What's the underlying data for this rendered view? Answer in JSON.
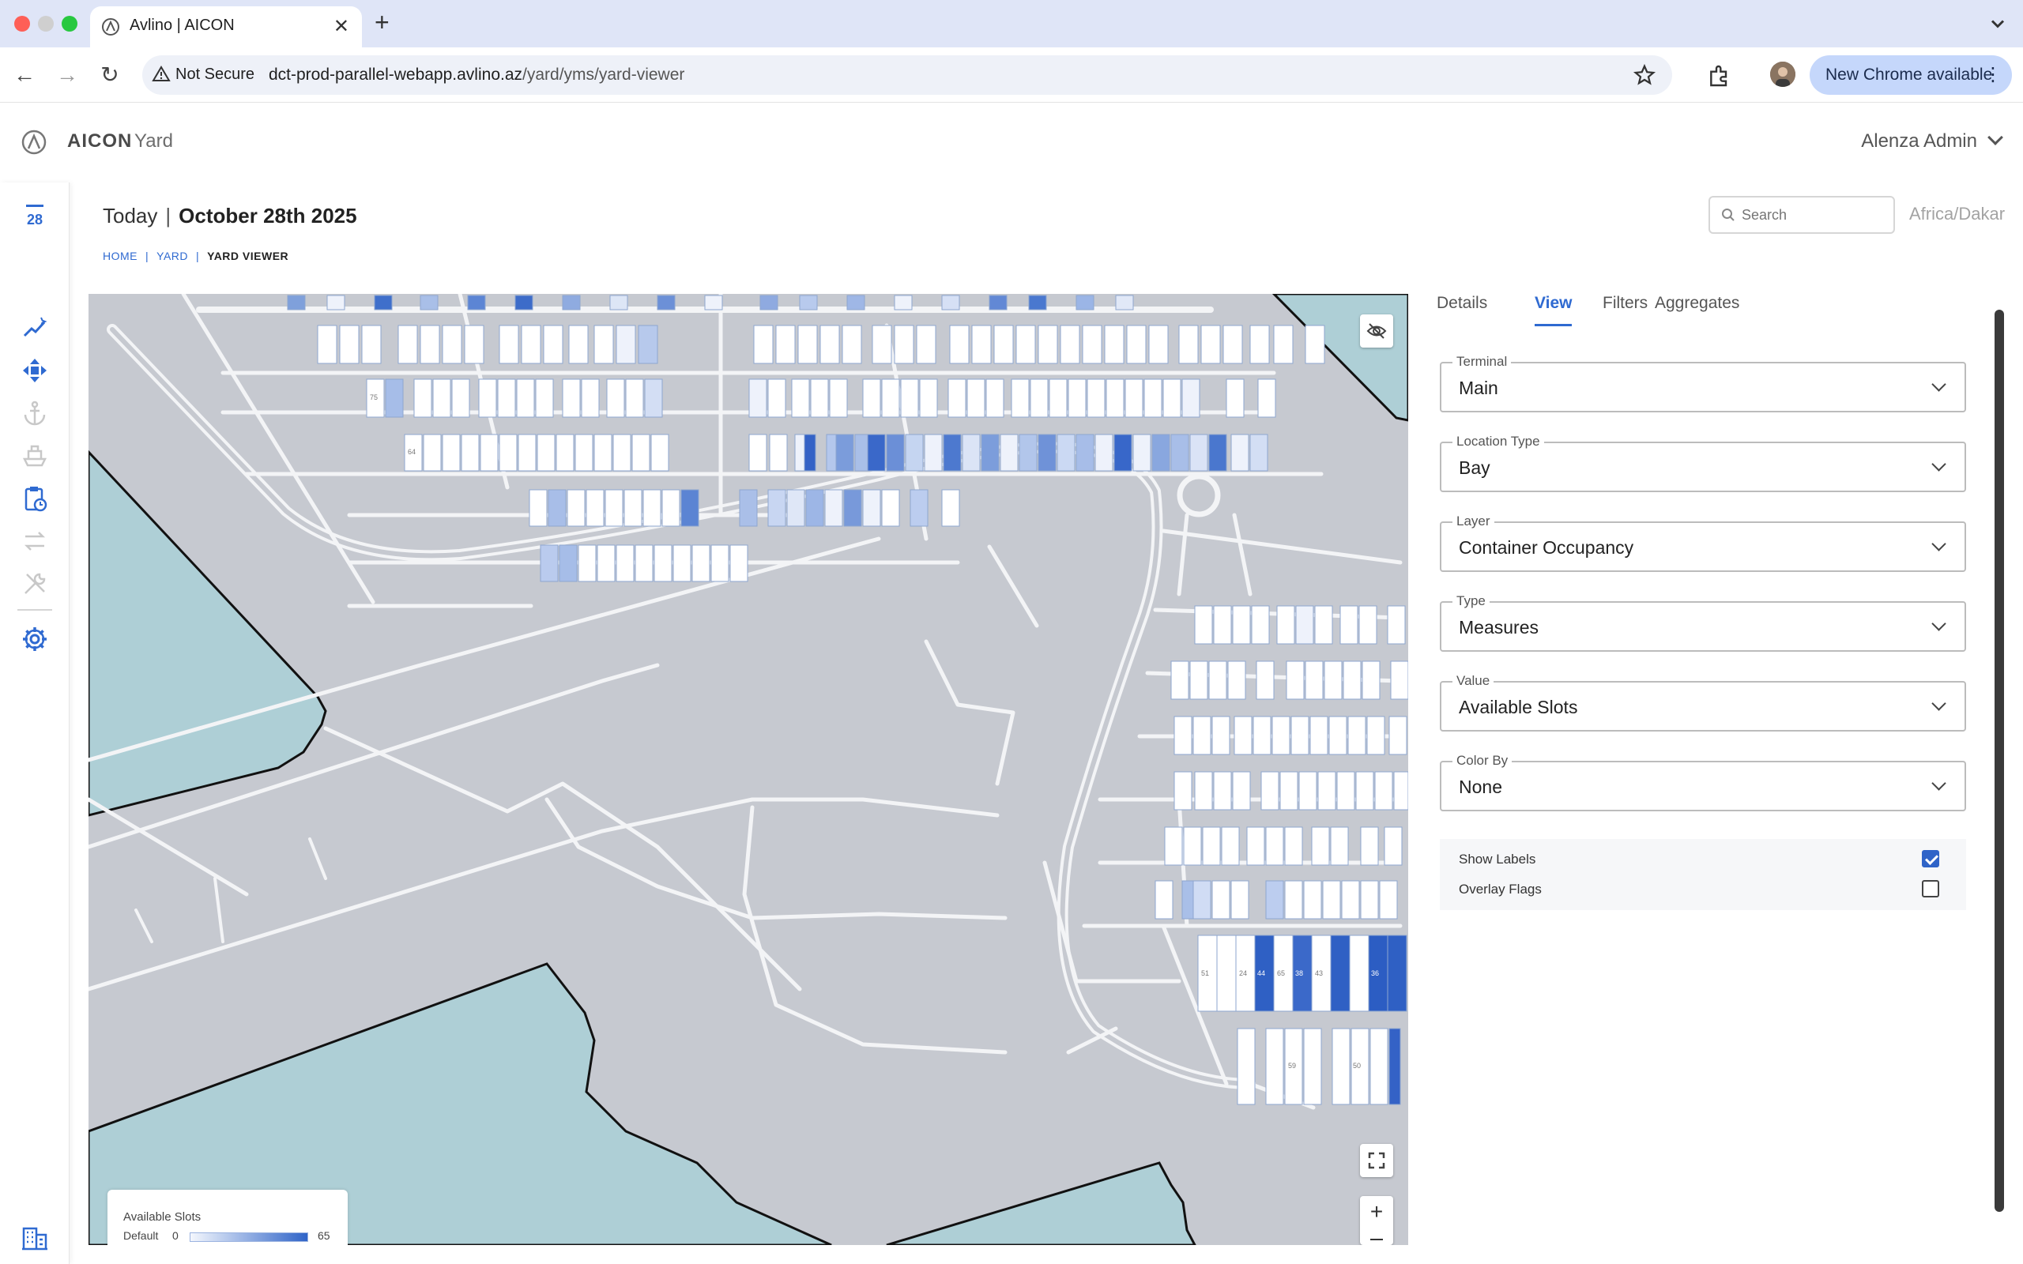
{
  "browser": {
    "tab_title": "Avlino | AICON",
    "security_label": "Not Secure",
    "url_host": "dct-prod-parallel-webapp.avlino.az",
    "url_path": "/yard/yms/yard-viewer",
    "update_label": "New Chrome available"
  },
  "app": {
    "brand": "AICON",
    "module": "Yard",
    "user_name": "Alenza Admin",
    "rail_calendar_day": "28"
  },
  "page": {
    "today_label": "Today",
    "date": "October 28th 2025",
    "breadcrumb": [
      "HOME",
      "YARD",
      "YARD VIEWER"
    ],
    "search_placeholder": "Search",
    "timezone": "Africa/Dakar"
  },
  "legend": {
    "title": "Available Slots",
    "row_label": "Default",
    "min": "0",
    "max": "65"
  },
  "map_labels": [
    "75",
    "64",
    "44",
    "38",
    "36",
    "51",
    "24",
    "65",
    "43",
    "50",
    "59"
  ],
  "panel": {
    "tabs": [
      "Details",
      "View",
      "Filters",
      "Aggregates"
    ],
    "active_tab": "View",
    "fields": [
      {
        "label": "Terminal",
        "value": "Main"
      },
      {
        "label": "Location Type",
        "value": "Bay"
      },
      {
        "label": "Layer",
        "value": "Container Occupancy"
      },
      {
        "label": "Type",
        "value": "Measures"
      },
      {
        "label": "Value",
        "value": "Available Slots"
      },
      {
        "label": "Color By",
        "value": "None"
      }
    ],
    "options": [
      {
        "label": "Show Labels",
        "checked": true
      },
      {
        "label": "Overlay Flags",
        "checked": false
      }
    ]
  },
  "colors": {
    "accent": "#2f6ad1",
    "water": "#aecfd6",
    "land": "#c6c9d0",
    "road": "#f3f4f6",
    "bay_high": "#2f64c8"
  }
}
